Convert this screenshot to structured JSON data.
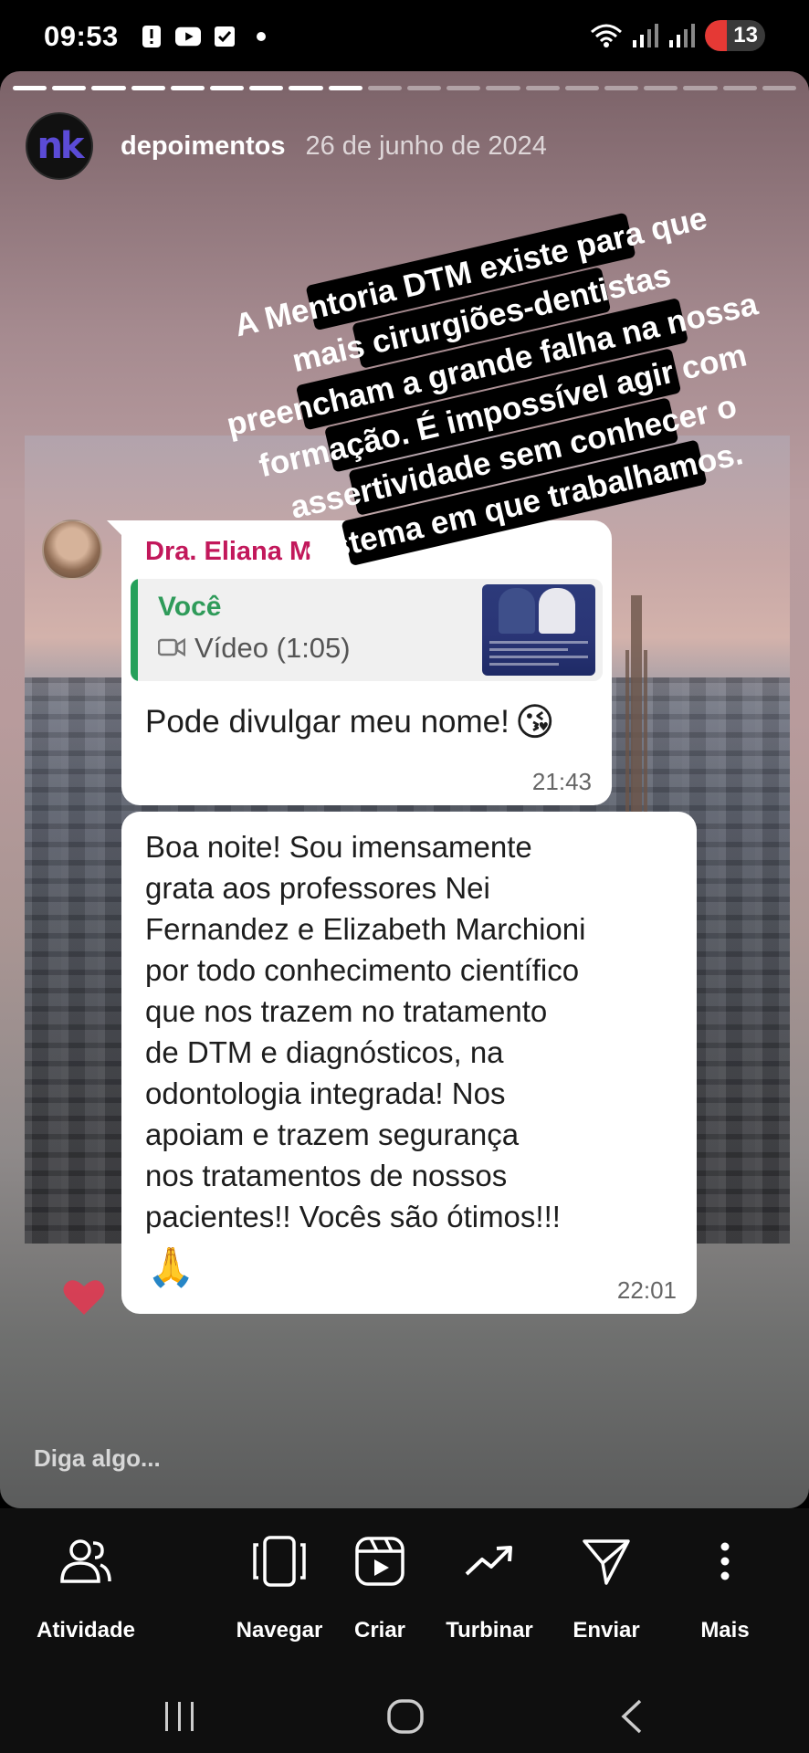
{
  "status": {
    "time": "09:53",
    "battery": "13"
  },
  "story": {
    "username": "depoimentos",
    "date": "26 de junho de 2024",
    "avatar_text": "nk",
    "progress_total": 20,
    "progress_current": 9,
    "caption_lines": [
      "A Mentoria DTM existe para que",
      "mais cirurgiões-dentistas",
      "preencham a grande falha na nossa",
      "formação. É impossível agir com",
      "assertividade sem conhecer o",
      "sistema em que trabalhamos."
    ],
    "reply_placeholder": "Diga algo..."
  },
  "chat": {
    "sender": "Dra. Eliana M",
    "quote_name": "Você",
    "quote_media": "Vídeo (1:05)",
    "message1": "Pode divulgar meu nome!",
    "message1_emoji": "😘",
    "time1": "21:43",
    "message2_lines": [
      "Boa noite! Sou imensamente",
      "grata aos professores Nei",
      "Fernandez e Elizabeth Marchioni",
      "por todo conhecimento científico",
      "que nos trazem no tratamento",
      "de DTM e diagnósticos, na",
      "odontologia integrada! Nos",
      "apoiam e trazem segurança",
      "nos tratamentos de nossos",
      "pacientes!! Vocês são ótimos!!!"
    ],
    "message2_emoji": "🙏",
    "time2": "22:01"
  },
  "actions": {
    "activity": "Atividade",
    "browse": "Navegar",
    "create": "Criar",
    "boost": "Turbinar",
    "send": "Enviar",
    "more": "Mais"
  },
  "icons": {
    "activity": "people-icon",
    "browse": "carousel-icon",
    "create": "reel-icon",
    "boost": "trending-icon",
    "send": "send-icon",
    "more": "more-vertical-icon"
  }
}
